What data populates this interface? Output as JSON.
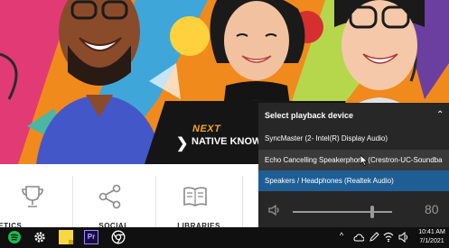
{
  "banner": {
    "next_label": "NEXT",
    "next_title": "NATIVE KNOWL"
  },
  "tiles": [
    {
      "label": "ATHLETICS",
      "icon": "trophy-icon"
    },
    {
      "label": "SOCIAL",
      "icon": "share-icon"
    },
    {
      "label": "LIBRARIES",
      "icon": "book-icon"
    }
  ],
  "playback": {
    "title": "Select playback device",
    "devices": [
      {
        "label": "SyncMaster (2- Intel(R) Display Audio)",
        "state": "normal"
      },
      {
        "label": "Echo Cancelling Speakerphone (Crestron-UC-Soundba",
        "state": "hover"
      },
      {
        "label": "Speakers / Headphones (Realtek Audio)",
        "state": "selected"
      }
    ],
    "volume": "80",
    "volume_fraction": 0.8
  },
  "taskbar": {
    "apps": [
      "spotify-icon",
      "settings-icon",
      "sticky-notes-icon",
      "premiere-pro-icon",
      "chrome-icon"
    ],
    "premiere_label": "Pr",
    "tray_chevron": "^",
    "time": "10:41 AM",
    "date": "7/1/2021"
  },
  "colors": {
    "flyout_bg": "#272727",
    "selected": "#1f5e95",
    "taskbar_bg": "#101010"
  }
}
